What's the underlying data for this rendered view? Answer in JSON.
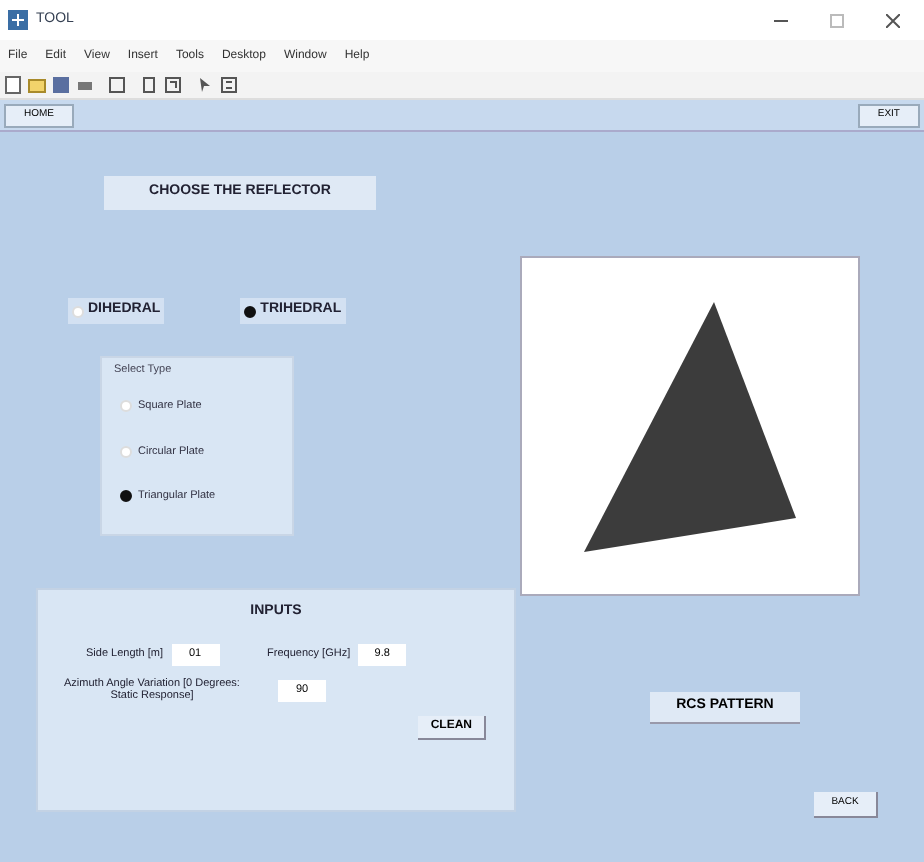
{
  "window": {
    "title": "TOOL"
  },
  "menu": [
    "File",
    "Edit",
    "View",
    "Insert",
    "Tools",
    "Desktop",
    "Window",
    "Help"
  ],
  "top_buttons": [
    {
      "label": "HOME"
    },
    {
      "label": "EXIT"
    }
  ],
  "heading": "CHOOSE THE REFLECTOR",
  "reflectors": [
    {
      "label": "DIHEDRAL",
      "selected": false
    },
    {
      "label": "TRIHEDRAL",
      "selected": true
    }
  ],
  "select_type": {
    "title": "Select Type",
    "options": [
      {
        "label": "Square Plate",
        "selected": false
      },
      {
        "label": "Circular Plate",
        "selected": false
      },
      {
        "label": "Triangular Plate",
        "selected": true
      }
    ]
  },
  "inputs": {
    "title": "INPUTS",
    "fields": [
      {
        "label": "Side Length [m]",
        "value": "01"
      },
      {
        "label": "Frequency [GHz]",
        "value": "9.8"
      },
      {
        "label": "Azimuth Angle Variation [0 Degrees: Static Response]",
        "value": "90"
      }
    ],
    "clear": "CLEAN"
  },
  "rcs_button": "RCS PATTERN",
  "back_button": "BACK"
}
